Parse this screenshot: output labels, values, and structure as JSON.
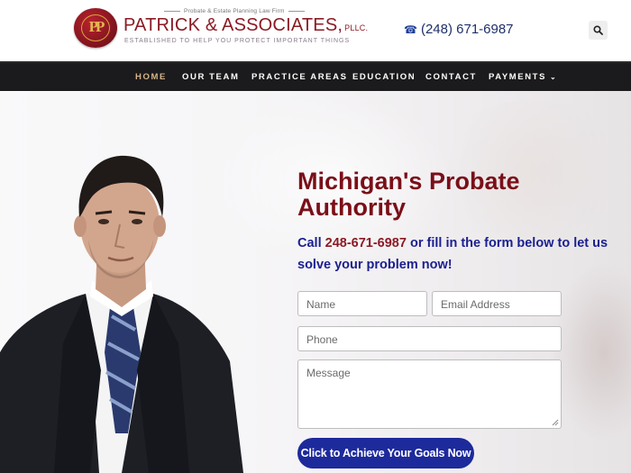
{
  "header": {
    "logo_monogram": "PP",
    "logo_tagline_top": "Probate & Estate Planning Law Firm",
    "logo_name": "PATRICK & ASSOCIATES,",
    "logo_pllc": "PLLC.",
    "logo_subtagline": "ESTABLISHED TO HELP YOU PROTECT IMPORTANT THINGS",
    "phone": "(248) 671-6987",
    "icons": {
      "phone": "phone-icon",
      "search": "search-icon"
    }
  },
  "nav": {
    "items": [
      {
        "label": "HOME",
        "active": true
      },
      {
        "label": "OUR TEAM",
        "active": false
      },
      {
        "label": "PRACTICE AREAS",
        "active": false
      },
      {
        "label": "EDUCATION",
        "active": false
      },
      {
        "label": "CONTACT",
        "active": false
      },
      {
        "label": "PAYMENTS",
        "active": false,
        "has_dropdown": true
      }
    ]
  },
  "hero": {
    "headline": "Michigan's Probate Authority",
    "sub_prefix": "Call",
    "sub_phone": "248-671-6987",
    "sub_suffix": "or fill in the form below to let us solve your problem now!",
    "form": {
      "name_placeholder": "Name",
      "email_placeholder": "Email Address",
      "phone_placeholder": "Phone",
      "message_placeholder": "Message",
      "submit_label": "Click to Achieve Your Goals Now"
    }
  },
  "colors": {
    "brand_red": "#8b1a24",
    "headline_red": "#7a0f18",
    "nav_bg": "#1b1b1d",
    "nav_active": "#d7b48a",
    "link_blue": "#1a1f8f",
    "button_blue": "#1d2a9b"
  }
}
